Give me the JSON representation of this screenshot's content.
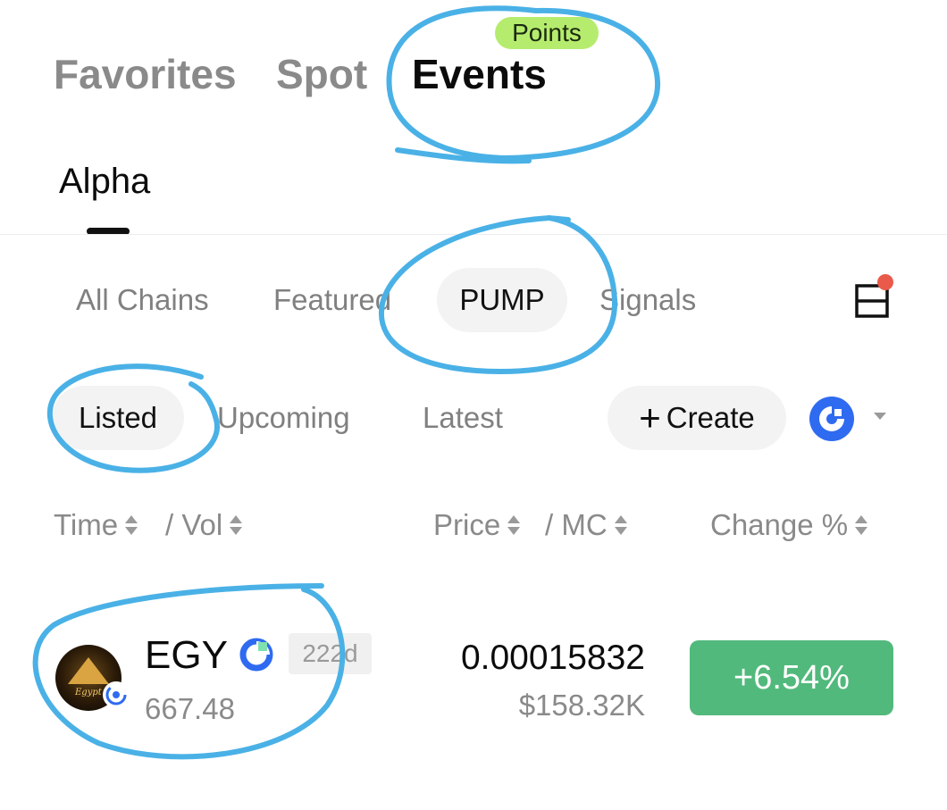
{
  "top_tabs": {
    "favorites": "Favorites",
    "spot": "Spot",
    "events": "Events",
    "events_badge": "Points",
    "alpha": "Alpha"
  },
  "chain_filters": {
    "all_chains": "All Chains",
    "featured": "Featured",
    "pump": "PUMP",
    "signals": "Signals"
  },
  "status_filters": {
    "listed": "Listed",
    "upcoming": "Upcoming",
    "latest": "Latest",
    "create_label": "Create",
    "create_plus": "+"
  },
  "columns": {
    "time": "Time",
    "vol": "/ Vol",
    "price": "Price",
    "mc": "/ MC",
    "change": "Change %"
  },
  "tokens": [
    {
      "symbol": "EGY",
      "age": "222d",
      "volume": "667.48",
      "price": "0.00015832",
      "market_cap": "$158.32K",
      "change": "+6.54%",
      "avatar_text": "Egypt",
      "change_color": "#52b97c"
    }
  ],
  "colors": {
    "accent_blue": "#2f6bf0",
    "badge_green": "#b6ec6e",
    "notification_red": "#ea5a4a",
    "annotation_blue": "#4ab1e6"
  },
  "icons": {
    "layout": "split-layout-icon",
    "chain": "chain-logo-icon",
    "sort": "sort-arrows-icon"
  }
}
